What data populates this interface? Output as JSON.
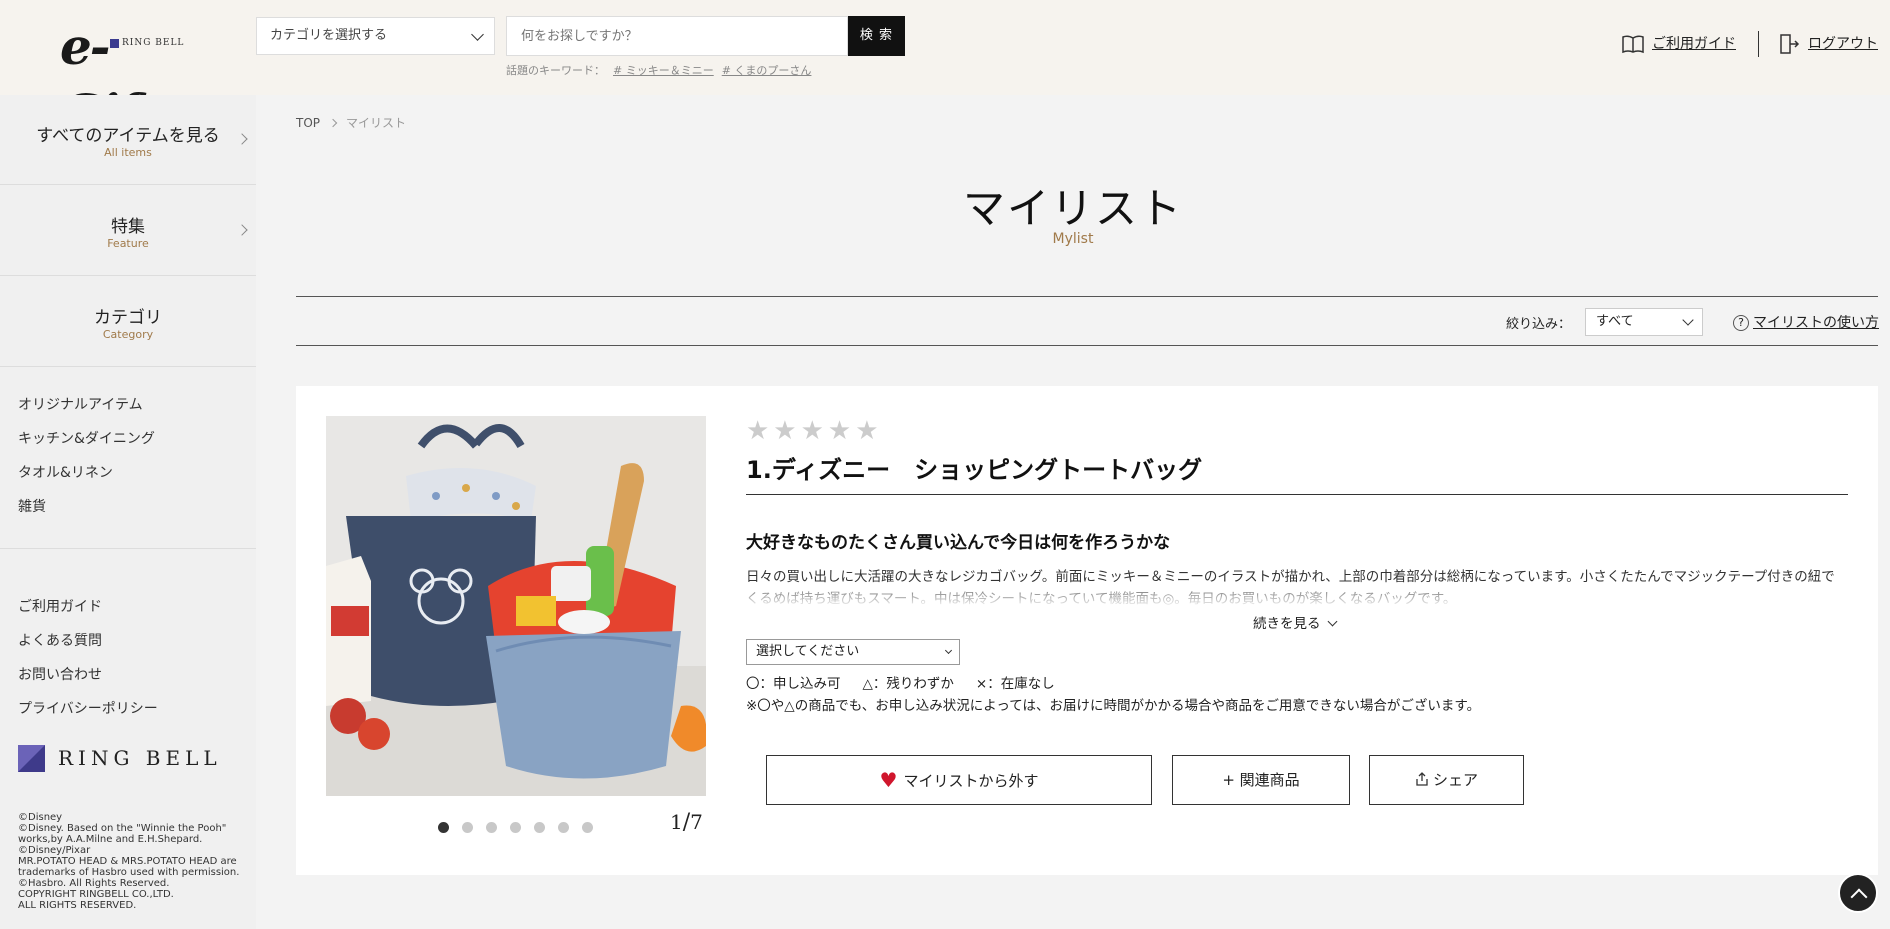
{
  "header": {
    "logo_text": "e-Gift",
    "logo_brand": "RING BELL",
    "category_select": {
      "value": "カテゴリを選択する"
    },
    "search": {
      "placeholder": "何をお探しですか？",
      "button_label": "検 索"
    },
    "keywords": {
      "label": "話題のキーワード：",
      "items": [
        "# ミッキー＆ミニー",
        "# くまのプーさん"
      ]
    },
    "guide_label": "ご利用ガイド",
    "logout_label": "ログアウト"
  },
  "sidebar": {
    "nav": [
      {
        "label": "すべてのアイテムを見る",
        "sub": "All items"
      },
      {
        "label": "特集",
        "sub": "Feature"
      },
      {
        "label": "カテゴリ",
        "sub": "Category"
      }
    ],
    "categories": [
      "オリジナルアイテム",
      "キッチン&ダイニング",
      "タオル&リネン",
      "雑貨"
    ],
    "links": [
      "ご利用ガイド",
      "よくある質問",
      "お問い合わせ",
      "プライバシーポリシー"
    ],
    "company_logo": "RING BELL",
    "copyright": [
      "©Disney",
      "©Disney. Based on the \"Winnie the Pooh\" works,by A.A.Milne and E.H.Shepard.",
      "©Disney/Pixar",
      "MR.POTATO HEAD & MRS.POTATO HEAD are trademarks of Hasbro used with permission. ©Hasbro. All Rights Reserved.",
      "COPYRIGHT RINGBELL CO.,LTD.",
      "ALL RIGHTS RESERVED."
    ]
  },
  "breadcrumb": {
    "home": "TOP",
    "current": "マイリスト"
  },
  "page": {
    "title": "マイリスト",
    "subtitle": "Mylist"
  },
  "filter": {
    "label": "絞り込み：",
    "value": "すべて",
    "howto_label": "マイリストの使い方"
  },
  "product": {
    "rating_stars": "★★★★★",
    "title": "1.ディズニー　ショッピングトートバッグ",
    "catch": "大好きなものたくさん買い込んで今日は何を作ろうかな",
    "description": "日々の買い出しに大活躍の大きなレジカゴバッグ。前面にミッキー＆ミニーのイラストが描かれ、上部の巾着部分は総柄になっています。小さくたたんでマジックテープ付きの紐でくるめば持ち運びもスマート。中は保冷シートになっていて機能面も◎。毎日のお買いものが楽しくなるバッグです。",
    "more_label": "続きを見る",
    "option_select": "選択してください",
    "legend": [
      "〇：申し込み可",
      "△：残りわずか",
      "×：在庫なし"
    ],
    "note": "※〇や△の商品でも、お申し込み状況によっては、お届けに時間がかかる場合や商品をご用意できない場合がございます。",
    "image_counter": {
      "current": "1",
      "total": "7"
    },
    "image_dots": 7,
    "buttons": {
      "remove": "マイリストから外す",
      "related": "+ 関連商品",
      "share": "シェア"
    }
  },
  "colors": {
    "accent_gold": "#a07a4a",
    "heart_red": "#d0162d",
    "header_bg": "#f6f3ee"
  }
}
